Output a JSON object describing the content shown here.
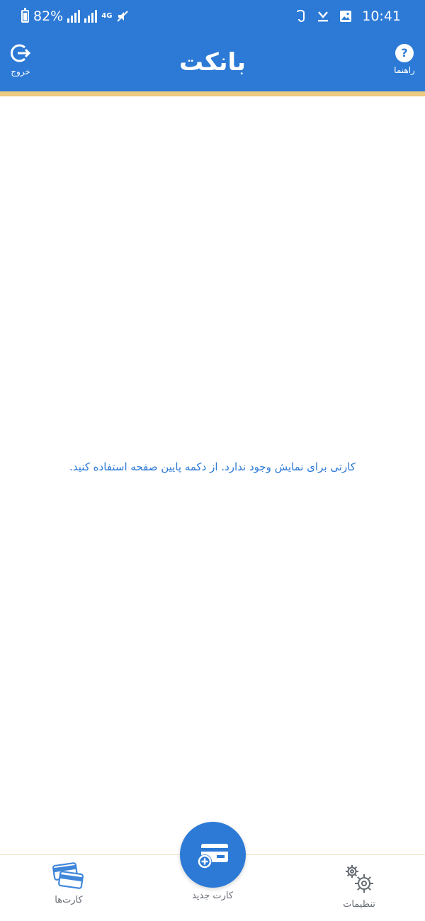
{
  "status_bar": {
    "time": "10:41",
    "battery": "82%",
    "network": "4G",
    "icons": [
      "battery-icon",
      "signal-icon",
      "signal-icon",
      "network-icon",
      "mute-icon",
      "gallery-icon",
      "download-icon",
      "notification-icon"
    ]
  },
  "header": {
    "logo": "بانکت",
    "left_button": {
      "label": "خروج",
      "icon": "logout-icon"
    },
    "right_button": {
      "label": "راهنما",
      "icon": "help-icon"
    }
  },
  "content": {
    "empty_message": "کارتی برای نمایش وجود ندارد. از دکمه پایین صفحه استفاده کنید."
  },
  "bottom_nav": {
    "left": {
      "label": "کارت‌ها",
      "icon": "cards-icon"
    },
    "center": {
      "label": "کارت جدید",
      "icon": "add-card-icon"
    },
    "right": {
      "label": "تنظیمات",
      "icon": "settings-icon"
    }
  },
  "colors": {
    "primary": "#2c7ad6",
    "accent": "#ebcb7f",
    "text_muted": "#666b72"
  }
}
